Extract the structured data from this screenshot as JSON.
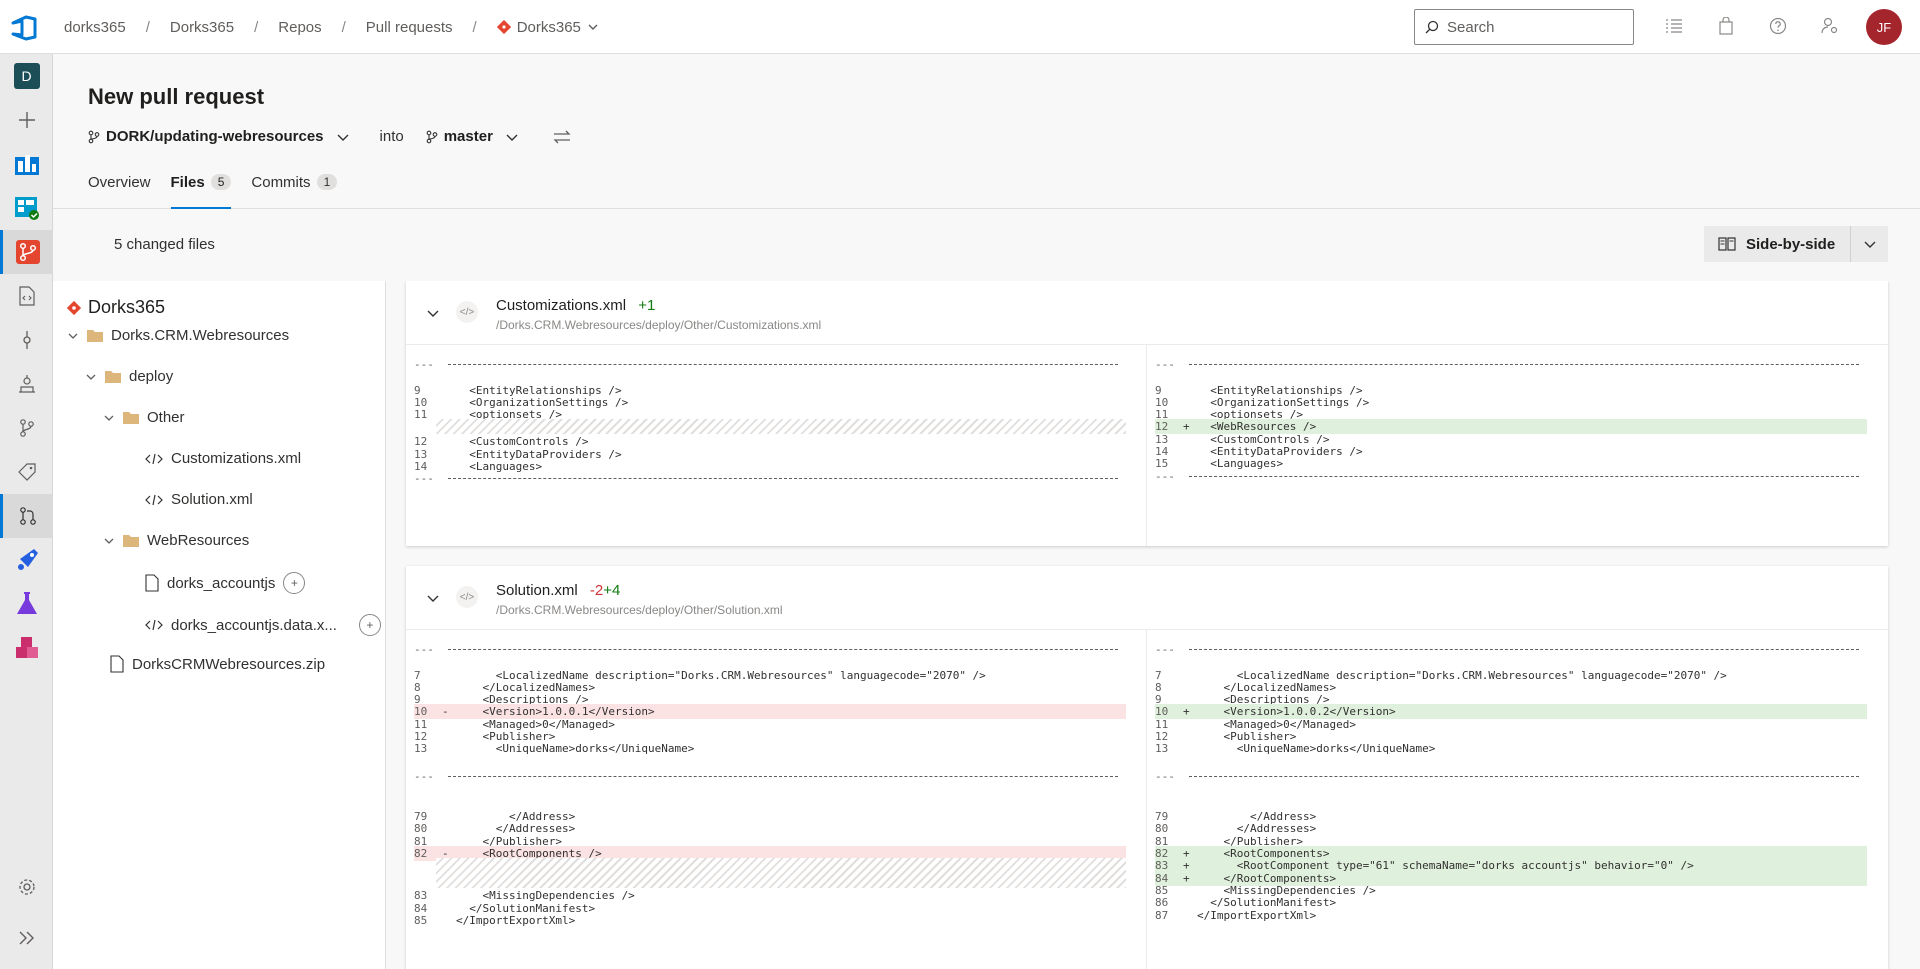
{
  "topbar": {
    "breadcrumbs": [
      "dorks365",
      "Dorks365",
      "Repos",
      "Pull requests"
    ],
    "repo_crumb": "Dorks365",
    "search_placeholder": "Search",
    "avatar_initials": "JF"
  },
  "leftnav": {
    "org_initial": "D",
    "items": [
      "add-icon",
      "overview-icon",
      "boards-icon",
      "repos-icon",
      "files-icon",
      "commits-icon",
      "pushes-icon",
      "branches-icon",
      "tags-icon",
      "pull-requests-icon",
      "pipelines-icon",
      "test-plans-icon",
      "artifacts-icon",
      "settings-icon",
      "expand-icon"
    ]
  },
  "page": {
    "title": "New pull request",
    "source_branch": "DORK/updating-webresources",
    "into_label": "into",
    "target_branch": "master",
    "tabs": [
      {
        "label": "Overview",
        "count": ""
      },
      {
        "label": "Files",
        "count": "5"
      },
      {
        "label": "Commits",
        "count": "1"
      }
    ],
    "changed_files": "5 changed files",
    "view_mode": "Side-by-side"
  },
  "tree": {
    "root": "Dorks365",
    "nodes": [
      {
        "label": "Dorks.CRM.Webresources"
      },
      {
        "label": "deploy"
      },
      {
        "label": "Other"
      },
      {
        "label": "Customizations.xml"
      },
      {
        "label": "Solution.xml"
      },
      {
        "label": "WebResources"
      },
      {
        "label": "dorks_accountjs",
        "badge": "+"
      },
      {
        "label": "dorks_accountjs.data.x...",
        "badge": "+"
      },
      {
        "label": "DorksCRMWebresources.zip"
      }
    ]
  },
  "files": [
    {
      "name": "Customizations.xml",
      "stat_removed": "",
      "stat_added": "+1",
      "path": "/Dorks.CRM.Webresources/deploy/Other/Customizations.xml",
      "left": [
        {
          "kind": "dash",
          "ln": "---"
        },
        {
          "kind": "line",
          "ln": "9",
          "mk": "",
          "text": "<EntityRelationships />",
          "indent": 1
        },
        {
          "kind": "line",
          "ln": "10",
          "mk": "",
          "text": "<OrganizationSettings />",
          "indent": 1
        },
        {
          "kind": "line",
          "ln": "11",
          "mk": "",
          "text": "<optionsets />",
          "indent": 1
        },
        {
          "kind": "hatch",
          "rows": 1
        },
        {
          "kind": "line",
          "ln": "12",
          "mk": "",
          "text": "<CustomControls />",
          "indent": 1
        },
        {
          "kind": "line",
          "ln": "13",
          "mk": "",
          "text": "<EntityDataProviders />",
          "indent": 1
        },
        {
          "kind": "line",
          "ln": "14",
          "mk": "",
          "text": "<Languages>",
          "indent": 1
        },
        {
          "kind": "dash",
          "ln": "---"
        }
      ],
      "right": [
        {
          "kind": "dash",
          "ln": "---"
        },
        {
          "kind": "line",
          "ln": "9",
          "mk": "",
          "text": "<EntityRelationships />",
          "indent": 1
        },
        {
          "kind": "line",
          "ln": "10",
          "mk": "",
          "text": "<OrganizationSettings />",
          "indent": 1
        },
        {
          "kind": "line",
          "ln": "11",
          "mk": "",
          "text": "<optionsets />",
          "indent": 1
        },
        {
          "kind": "added",
          "ln": "12",
          "mk": "+",
          "text": "<WebResources />",
          "indent": 1
        },
        {
          "kind": "line",
          "ln": "13",
          "mk": "",
          "text": "<CustomControls />",
          "indent": 1
        },
        {
          "kind": "line",
          "ln": "14",
          "mk": "",
          "text": "<EntityDataProviders />",
          "indent": 1
        },
        {
          "kind": "line",
          "ln": "15",
          "mk": "",
          "text": "<Languages>",
          "indent": 1
        },
        {
          "kind": "dash",
          "ln": "---"
        }
      ]
    },
    {
      "name": "Solution.xml",
      "stat_removed": "-2",
      "stat_added": "+4",
      "path": "/Dorks.CRM.Webresources/deploy/Other/Solution.xml",
      "left": [
        {
          "kind": "dash",
          "ln": "---"
        },
        {
          "kind": "line",
          "ln": "7",
          "mk": "",
          "text": "<LocalizedName description=\"Dorks.CRM.Webresources\" languagecode=\"2070\" />",
          "indent": 3
        },
        {
          "kind": "line",
          "ln": "8",
          "mk": "",
          "text": "</LocalizedNames>",
          "indent": 2
        },
        {
          "kind": "line",
          "ln": "9",
          "mk": "",
          "text": "<Descriptions />",
          "indent": 2
        },
        {
          "kind": "removed",
          "ln": "10",
          "mk": "-",
          "text": "<Version>1.0.0.1</Version>",
          "indent": 2
        },
        {
          "kind": "line",
          "ln": "11",
          "mk": "",
          "text": "<Managed>0</Managed>",
          "indent": 2
        },
        {
          "kind": "line",
          "ln": "12",
          "mk": "",
          "text": "<Publisher>",
          "indent": 2
        },
        {
          "kind": "line",
          "ln": "13",
          "mk": "",
          "text": "<UniqueName>dorks</UniqueName>",
          "indent": 3
        },
        {
          "kind": "blank"
        },
        {
          "kind": "dash",
          "ln": "---"
        },
        {
          "kind": "blank"
        },
        {
          "kind": "line",
          "ln": "79",
          "mk": "",
          "text": "</Address>",
          "indent": 4
        },
        {
          "kind": "line",
          "ln": "80",
          "mk": "",
          "text": "</Addresses>",
          "indent": 3
        },
        {
          "kind": "line",
          "ln": "81",
          "mk": "",
          "text": "</Publisher>",
          "indent": 2
        },
        {
          "kind": "removed",
          "ln": "82",
          "mk": "-",
          "text": "<RootComponents />",
          "indent": 2
        },
        {
          "kind": "hatch",
          "rows": 2
        },
        {
          "kind": "line",
          "ln": "83",
          "mk": "",
          "text": "<MissingDependencies />",
          "indent": 2
        },
        {
          "kind": "line",
          "ln": "84",
          "mk": "",
          "text": "</SolutionManifest>",
          "indent": 1
        },
        {
          "kind": "line",
          "ln": "85",
          "mk": "",
          "text": "</ImportExportXml>",
          "indent": 0
        }
      ],
      "right": [
        {
          "kind": "dash",
          "ln": "---"
        },
        {
          "kind": "line",
          "ln": "7",
          "mk": "",
          "text": "<LocalizedName description=\"Dorks.CRM.Webresources\" languagecode=\"2070\" />",
          "indent": 3
        },
        {
          "kind": "line",
          "ln": "8",
          "mk": "",
          "text": "</LocalizedNames>",
          "indent": 2
        },
        {
          "kind": "line",
          "ln": "9",
          "mk": "",
          "text": "<Descriptions />",
          "indent": 2
        },
        {
          "kind": "added",
          "ln": "10",
          "mk": "+",
          "text": "<Version>1.0.0.2</Version>",
          "indent": 2
        },
        {
          "kind": "line",
          "ln": "11",
          "mk": "",
          "text": "<Managed>0</Managed>",
          "indent": 2
        },
        {
          "kind": "line",
          "ln": "12",
          "mk": "",
          "text": "<Publisher>",
          "indent": 2
        },
        {
          "kind": "line",
          "ln": "13",
          "mk": "",
          "text": "<UniqueName>dorks</UniqueName>",
          "indent": 3
        },
        {
          "kind": "blank"
        },
        {
          "kind": "dash",
          "ln": "---"
        },
        {
          "kind": "blank"
        },
        {
          "kind": "line",
          "ln": "79",
          "mk": "",
          "text": "</Address>",
          "indent": 4
        },
        {
          "kind": "line",
          "ln": "80",
          "mk": "",
          "text": "</Addresses>",
          "indent": 3
        },
        {
          "kind": "line",
          "ln": "81",
          "mk": "",
          "text": "</Publisher>",
          "indent": 2
        },
        {
          "kind": "added",
          "ln": "82",
          "mk": "+",
          "text": "<RootComponents>",
          "indent": 2
        },
        {
          "kind": "added",
          "ln": "83",
          "mk": "+",
          "text": "<RootComponent type=\"61\" schemaName=\"dorks_accountjs\" behavior=\"0\" />",
          "indent": 3
        },
        {
          "kind": "added",
          "ln": "84",
          "mk": "+",
          "text": "</RootComponents>",
          "indent": 2
        },
        {
          "kind": "line",
          "ln": "85",
          "mk": "",
          "text": "<MissingDependencies />",
          "indent": 2
        },
        {
          "kind": "line",
          "ln": "86",
          "mk": "",
          "text": "</SolutionManifest>",
          "indent": 1
        },
        {
          "kind": "line",
          "ln": "87",
          "mk": "",
          "text": "</ImportExportXml>",
          "indent": 0
        }
      ]
    }
  ]
}
